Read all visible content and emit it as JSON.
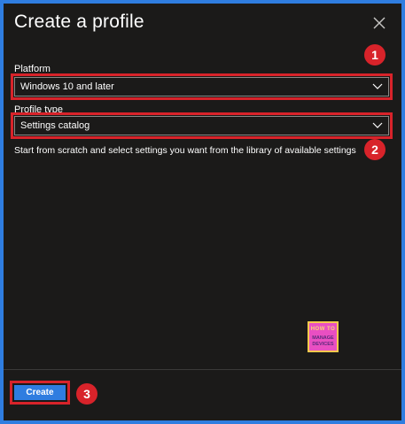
{
  "dialog": {
    "title": "Create a profile",
    "close_icon": "close-icon"
  },
  "platform": {
    "label": "Platform",
    "value": "Windows 10 and later"
  },
  "profile_type": {
    "label": "Profile type",
    "value": "Settings catalog",
    "description": "Start from scratch and select settings you want from the library of available settings"
  },
  "annotations": {
    "step1": "1",
    "step2": "2",
    "step3": "3",
    "highlight_color": "#d8232a"
  },
  "watermark": {
    "line1": "HOW TO",
    "line2": "MANAGE DEVICES"
  },
  "footer": {
    "create_label": "Create"
  },
  "colors": {
    "accent": "#2f7de0",
    "background": "#1b1a19",
    "text": "#ffffff"
  }
}
